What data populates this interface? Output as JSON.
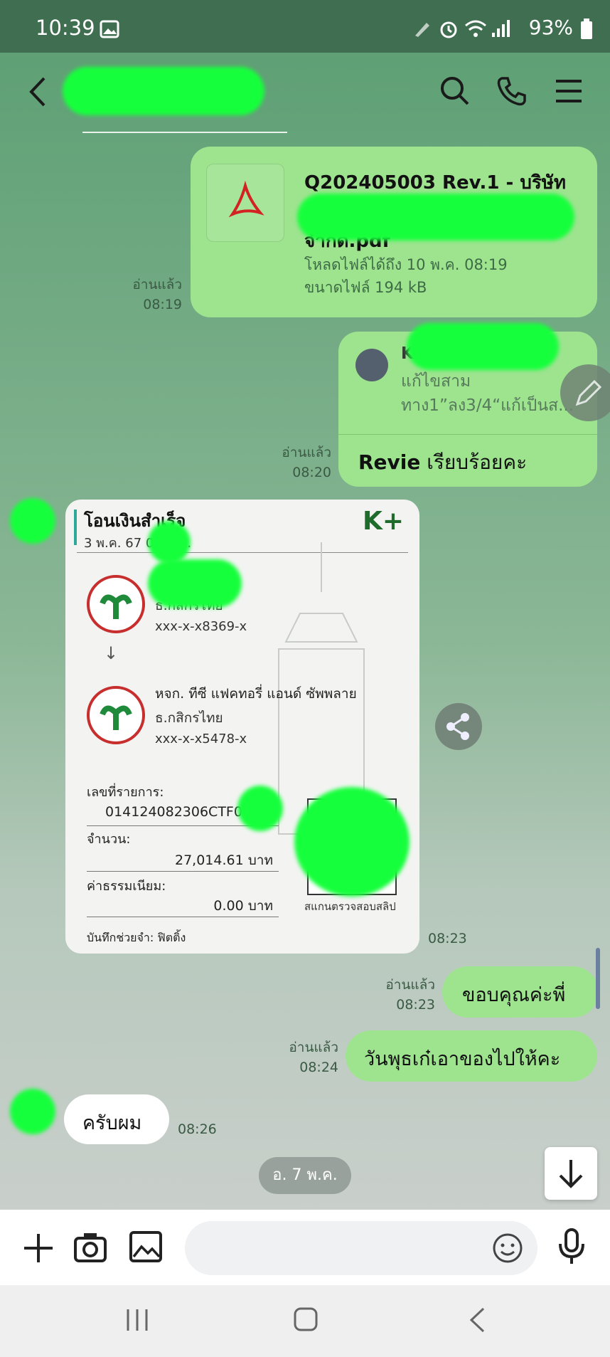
{
  "status_bar": {
    "time": "10:39",
    "battery": "93%"
  },
  "header": {
    "back_label": "<"
  },
  "messages": [
    {
      "type": "file",
      "title": "Q202405003 Rev.1 - บริษัท",
      "name_suffix": "จำกัด.pdf",
      "download": "โหลดไฟล์ได้ถึง 10 พ.ค. 08:19",
      "size": "ขนาดไฟล์ 194 kB",
      "read": "อ่านแล้ว",
      "time": "08:19"
    },
    {
      "type": "reply",
      "quoted_initial": "K",
      "quoted_line1": "แก้ไขสาม",
      "quoted_line2": "ทาง1”ลง3/4“แก้เป็นส...",
      "text_bold": "Revie",
      "text": " เรียบร้อยคะ",
      "read": "อ่านแล้ว",
      "time": "08:20"
    },
    {
      "type": "slip",
      "slip_title": "โอนเงินสำเร็จ",
      "slip_date": "3 พ.ค. 67  08:1 น.",
      "brand": "K+",
      "from_bank": "ธ.กสิกรไทย",
      "from_acct": "xxx-x-x8369-x",
      "arrow": "↓",
      "to_name": "หจก. ทีซี แฟคทอรี่ แอนด์ ซัพพลาย",
      "to_bank": "ธ.กสิกรไทย",
      "to_acct": "xxx-x-x5478-x",
      "ref_label": "เลขที่รายการ:",
      "ref_value": "014124082306CTF0",
      "amount_label": "จำนวน:",
      "amount_value": "27,014.61 บาท",
      "fee_label": "ค่าธรรมเนียม:",
      "fee_value": "0.00 บาท",
      "qr_caption": "สแกนตรวจสอบสลิป",
      "memo": "บันทึกช่วยจำ: ฟิตติ้ง",
      "time": "08:23"
    },
    {
      "type": "text",
      "text": "ขอบคุณค่ะพี่",
      "read": "อ่านแล้ว",
      "time": "08:23"
    },
    {
      "type": "text",
      "text": "วันพุธเก๋เอาของไปให้คะ",
      "read": "อ่านแล้ว",
      "time": "08:24"
    },
    {
      "type": "incoming",
      "text": "ครับผม",
      "time": "08:26"
    }
  ],
  "date_chip": "อ. 7 พ.ค.",
  "composer": {
    "placeholder": ""
  },
  "colors": {
    "accent_green": "#9ee48f",
    "header_bg": "#3f6f50"
  },
  "icons": [
    "back-icon",
    "search-icon",
    "phone-icon",
    "menu-icon",
    "pdf-icon",
    "edit-icon",
    "share-icon",
    "scroll-down-icon",
    "plus-icon",
    "camera-icon",
    "image-icon",
    "emoji-icon",
    "mic-icon",
    "recents-icon",
    "home-icon",
    "nav-back-icon"
  ]
}
